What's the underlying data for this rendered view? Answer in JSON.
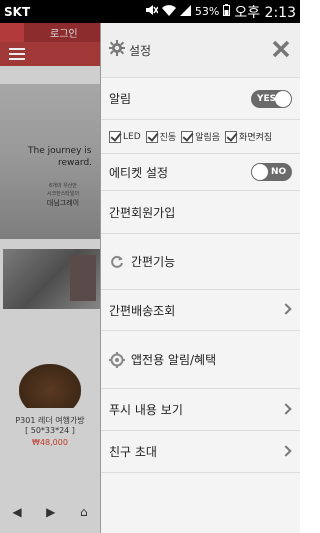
{
  "status_bar": {
    "carrier": "SKT",
    "battery": "53%",
    "time": "오후 2:13"
  },
  "background_app": {
    "login": "로그인",
    "banner_line1": "The journey is",
    "banner_line2": "reward.",
    "banner_small1": "6개의 우산안",
    "banner_small2": "시크한스타일의",
    "banner_small3": "대님그레이",
    "product_name": "P301 레더 여행가방",
    "product_size": "[ 50*33*24 ]",
    "product_price": "₩48,000"
  },
  "drawer": {
    "header_title": "설정",
    "alarm_label": "알림",
    "alarm_toggle": "YES",
    "checks": [
      {
        "label": "LED"
      },
      {
        "label": "진동"
      },
      {
        "label": "알림음"
      },
      {
        "label": "화면켜짐"
      }
    ],
    "etiquette_label": "에티켓 설정",
    "etiquette_toggle": "NO",
    "signup_label": "간편회원가입",
    "easy_label": "간편기능",
    "delivery_label": "간편배송조회",
    "app_alarm_label": "앱전용 알림/혜택",
    "push_label": "푸시 내용 보기",
    "invite_label": "친구 초대"
  }
}
